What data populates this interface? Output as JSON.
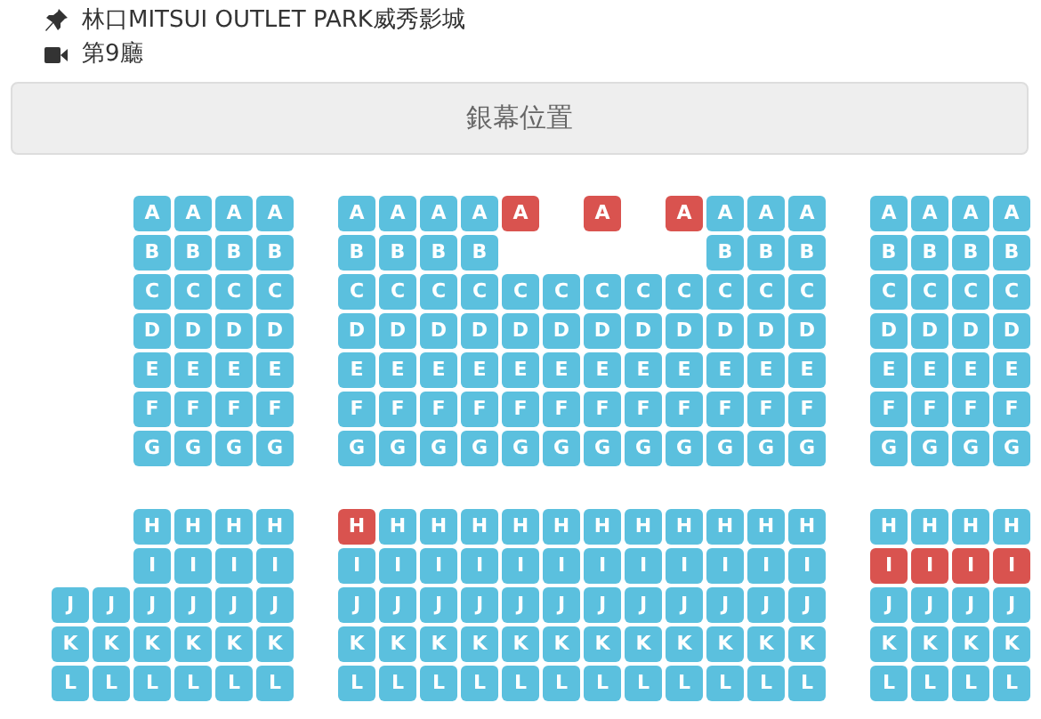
{
  "location": "林口MITSUI OUTLET PARK威秀影城",
  "hall": "第9廳",
  "screen": "銀幕位置",
  "sections": [
    {
      "rows": [
        {
          "seats": [
            {
              "kind": "gap"
            },
            {
              "kind": "gap"
            },
            {
              "kind": "seat",
              "label": "A",
              "taken": false
            },
            {
              "kind": "seat",
              "label": "A",
              "taken": false
            },
            {
              "kind": "seat",
              "label": "A",
              "taken": false
            },
            {
              "kind": "seat",
              "label": "A",
              "taken": false
            },
            {
              "kind": "gap"
            },
            {
              "kind": "seat",
              "label": "A",
              "taken": false
            },
            {
              "kind": "seat",
              "label": "A",
              "taken": false
            },
            {
              "kind": "seat",
              "label": "A",
              "taken": false
            },
            {
              "kind": "seat",
              "label": "A",
              "taken": false
            },
            {
              "kind": "seat",
              "label": "A",
              "taken": true
            },
            {
              "kind": "gap"
            },
            {
              "kind": "seat",
              "label": "A",
              "taken": true
            },
            {
              "kind": "gap"
            },
            {
              "kind": "seat",
              "label": "A",
              "taken": true
            },
            {
              "kind": "seat",
              "label": "A",
              "taken": false
            },
            {
              "kind": "seat",
              "label": "A",
              "taken": false
            },
            {
              "kind": "seat",
              "label": "A",
              "taken": false
            },
            {
              "kind": "gap"
            },
            {
              "kind": "seat",
              "label": "A",
              "taken": false
            },
            {
              "kind": "seat",
              "label": "A",
              "taken": false
            },
            {
              "kind": "seat",
              "label": "A",
              "taken": false
            },
            {
              "kind": "seat",
              "label": "A",
              "taken": false
            }
          ]
        },
        {
          "seats": [
            {
              "kind": "gap"
            },
            {
              "kind": "gap"
            },
            {
              "kind": "seat",
              "label": "B",
              "taken": false
            },
            {
              "kind": "seat",
              "label": "B",
              "taken": false
            },
            {
              "kind": "seat",
              "label": "B",
              "taken": false
            },
            {
              "kind": "seat",
              "label": "B",
              "taken": false
            },
            {
              "kind": "gap"
            },
            {
              "kind": "seat",
              "label": "B",
              "taken": false
            },
            {
              "kind": "seat",
              "label": "B",
              "taken": false
            },
            {
              "kind": "seat",
              "label": "B",
              "taken": false
            },
            {
              "kind": "seat",
              "label": "B",
              "taken": false
            },
            {
              "kind": "gap"
            },
            {
              "kind": "gap"
            },
            {
              "kind": "gap"
            },
            {
              "kind": "gap"
            },
            {
              "kind": "gap"
            },
            {
              "kind": "seat",
              "label": "B",
              "taken": false
            },
            {
              "kind": "seat",
              "label": "B",
              "taken": false
            },
            {
              "kind": "seat",
              "label": "B",
              "taken": false
            },
            {
              "kind": "gap"
            },
            {
              "kind": "seat",
              "label": "B",
              "taken": false
            },
            {
              "kind": "seat",
              "label": "B",
              "taken": false
            },
            {
              "kind": "seat",
              "label": "B",
              "taken": false
            },
            {
              "kind": "seat",
              "label": "B",
              "taken": false
            }
          ]
        },
        {
          "seats": [
            {
              "kind": "gap"
            },
            {
              "kind": "gap"
            },
            {
              "kind": "seat",
              "label": "C",
              "taken": false
            },
            {
              "kind": "seat",
              "label": "C",
              "taken": false
            },
            {
              "kind": "seat",
              "label": "C",
              "taken": false
            },
            {
              "kind": "seat",
              "label": "C",
              "taken": false
            },
            {
              "kind": "gap"
            },
            {
              "kind": "seat",
              "label": "C",
              "taken": false
            },
            {
              "kind": "seat",
              "label": "C",
              "taken": false
            },
            {
              "kind": "seat",
              "label": "C",
              "taken": false
            },
            {
              "kind": "seat",
              "label": "C",
              "taken": false
            },
            {
              "kind": "seat",
              "label": "C",
              "taken": false
            },
            {
              "kind": "seat",
              "label": "C",
              "taken": false
            },
            {
              "kind": "seat",
              "label": "C",
              "taken": false
            },
            {
              "kind": "seat",
              "label": "C",
              "taken": false
            },
            {
              "kind": "seat",
              "label": "C",
              "taken": false
            },
            {
              "kind": "seat",
              "label": "C",
              "taken": false
            },
            {
              "kind": "seat",
              "label": "C",
              "taken": false
            },
            {
              "kind": "seat",
              "label": "C",
              "taken": false
            },
            {
              "kind": "gap"
            },
            {
              "kind": "seat",
              "label": "C",
              "taken": false
            },
            {
              "kind": "seat",
              "label": "C",
              "taken": false
            },
            {
              "kind": "seat",
              "label": "C",
              "taken": false
            },
            {
              "kind": "seat",
              "label": "C",
              "taken": false
            }
          ]
        },
        {
          "seats": [
            {
              "kind": "gap"
            },
            {
              "kind": "gap"
            },
            {
              "kind": "seat",
              "label": "D",
              "taken": false
            },
            {
              "kind": "seat",
              "label": "D",
              "taken": false
            },
            {
              "kind": "seat",
              "label": "D",
              "taken": false
            },
            {
              "kind": "seat",
              "label": "D",
              "taken": false
            },
            {
              "kind": "gap"
            },
            {
              "kind": "seat",
              "label": "D",
              "taken": false
            },
            {
              "kind": "seat",
              "label": "D",
              "taken": false
            },
            {
              "kind": "seat",
              "label": "D",
              "taken": false
            },
            {
              "kind": "seat",
              "label": "D",
              "taken": false
            },
            {
              "kind": "seat",
              "label": "D",
              "taken": false
            },
            {
              "kind": "seat",
              "label": "D",
              "taken": false
            },
            {
              "kind": "seat",
              "label": "D",
              "taken": false
            },
            {
              "kind": "seat",
              "label": "D",
              "taken": false
            },
            {
              "kind": "seat",
              "label": "D",
              "taken": false
            },
            {
              "kind": "seat",
              "label": "D",
              "taken": false
            },
            {
              "kind": "seat",
              "label": "D",
              "taken": false
            },
            {
              "kind": "seat",
              "label": "D",
              "taken": false
            },
            {
              "kind": "gap"
            },
            {
              "kind": "seat",
              "label": "D",
              "taken": false
            },
            {
              "kind": "seat",
              "label": "D",
              "taken": false
            },
            {
              "kind": "seat",
              "label": "D",
              "taken": false
            },
            {
              "kind": "seat",
              "label": "D",
              "taken": false
            }
          ]
        },
        {
          "seats": [
            {
              "kind": "gap"
            },
            {
              "kind": "gap"
            },
            {
              "kind": "seat",
              "label": "E",
              "taken": false
            },
            {
              "kind": "seat",
              "label": "E",
              "taken": false
            },
            {
              "kind": "seat",
              "label": "E",
              "taken": false
            },
            {
              "kind": "seat",
              "label": "E",
              "taken": false
            },
            {
              "kind": "gap"
            },
            {
              "kind": "seat",
              "label": "E",
              "taken": false
            },
            {
              "kind": "seat",
              "label": "E",
              "taken": false
            },
            {
              "kind": "seat",
              "label": "E",
              "taken": false
            },
            {
              "kind": "seat",
              "label": "E",
              "taken": false
            },
            {
              "kind": "seat",
              "label": "E",
              "taken": false
            },
            {
              "kind": "seat",
              "label": "E",
              "taken": false
            },
            {
              "kind": "seat",
              "label": "E",
              "taken": false
            },
            {
              "kind": "seat",
              "label": "E",
              "taken": false
            },
            {
              "kind": "seat",
              "label": "E",
              "taken": false
            },
            {
              "kind": "seat",
              "label": "E",
              "taken": false
            },
            {
              "kind": "seat",
              "label": "E",
              "taken": false
            },
            {
              "kind": "seat",
              "label": "E",
              "taken": false
            },
            {
              "kind": "gap"
            },
            {
              "kind": "seat",
              "label": "E",
              "taken": false
            },
            {
              "kind": "seat",
              "label": "E",
              "taken": false
            },
            {
              "kind": "seat",
              "label": "E",
              "taken": false
            },
            {
              "kind": "seat",
              "label": "E",
              "taken": false
            }
          ]
        },
        {
          "seats": [
            {
              "kind": "gap"
            },
            {
              "kind": "gap"
            },
            {
              "kind": "seat",
              "label": "F",
              "taken": false
            },
            {
              "kind": "seat",
              "label": "F",
              "taken": false
            },
            {
              "kind": "seat",
              "label": "F",
              "taken": false
            },
            {
              "kind": "seat",
              "label": "F",
              "taken": false
            },
            {
              "kind": "gap"
            },
            {
              "kind": "seat",
              "label": "F",
              "taken": false
            },
            {
              "kind": "seat",
              "label": "F",
              "taken": false
            },
            {
              "kind": "seat",
              "label": "F",
              "taken": false
            },
            {
              "kind": "seat",
              "label": "F",
              "taken": false
            },
            {
              "kind": "seat",
              "label": "F",
              "taken": false
            },
            {
              "kind": "seat",
              "label": "F",
              "taken": false
            },
            {
              "kind": "seat",
              "label": "F",
              "taken": false
            },
            {
              "kind": "seat",
              "label": "F",
              "taken": false
            },
            {
              "kind": "seat",
              "label": "F",
              "taken": false
            },
            {
              "kind": "seat",
              "label": "F",
              "taken": false
            },
            {
              "kind": "seat",
              "label": "F",
              "taken": false
            },
            {
              "kind": "seat",
              "label": "F",
              "taken": false
            },
            {
              "kind": "gap"
            },
            {
              "kind": "seat",
              "label": "F",
              "taken": false
            },
            {
              "kind": "seat",
              "label": "F",
              "taken": false
            },
            {
              "kind": "seat",
              "label": "F",
              "taken": false
            },
            {
              "kind": "seat",
              "label": "F",
              "taken": false
            }
          ]
        },
        {
          "seats": [
            {
              "kind": "gap"
            },
            {
              "kind": "gap"
            },
            {
              "kind": "seat",
              "label": "G",
              "taken": false
            },
            {
              "kind": "seat",
              "label": "G",
              "taken": false
            },
            {
              "kind": "seat",
              "label": "G",
              "taken": false
            },
            {
              "kind": "seat",
              "label": "G",
              "taken": false
            },
            {
              "kind": "gap"
            },
            {
              "kind": "seat",
              "label": "G",
              "taken": false
            },
            {
              "kind": "seat",
              "label": "G",
              "taken": false
            },
            {
              "kind": "seat",
              "label": "G",
              "taken": false
            },
            {
              "kind": "seat",
              "label": "G",
              "taken": false
            },
            {
              "kind": "seat",
              "label": "G",
              "taken": false
            },
            {
              "kind": "seat",
              "label": "G",
              "taken": false
            },
            {
              "kind": "seat",
              "label": "G",
              "taken": false
            },
            {
              "kind": "seat",
              "label": "G",
              "taken": false
            },
            {
              "kind": "seat",
              "label": "G",
              "taken": false
            },
            {
              "kind": "seat",
              "label": "G",
              "taken": false
            },
            {
              "kind": "seat",
              "label": "G",
              "taken": false
            },
            {
              "kind": "seat",
              "label": "G",
              "taken": false
            },
            {
              "kind": "gap"
            },
            {
              "kind": "seat",
              "label": "G",
              "taken": false
            },
            {
              "kind": "seat",
              "label": "G",
              "taken": false
            },
            {
              "kind": "seat",
              "label": "G",
              "taken": false
            },
            {
              "kind": "seat",
              "label": "G",
              "taken": false
            }
          ]
        }
      ]
    },
    {
      "rows": [
        {
          "seats": [
            {
              "kind": "gap"
            },
            {
              "kind": "gap"
            },
            {
              "kind": "seat",
              "label": "H",
              "taken": false
            },
            {
              "kind": "seat",
              "label": "H",
              "taken": false
            },
            {
              "kind": "seat",
              "label": "H",
              "taken": false
            },
            {
              "kind": "seat",
              "label": "H",
              "taken": false
            },
            {
              "kind": "gap"
            },
            {
              "kind": "seat",
              "label": "H",
              "taken": true
            },
            {
              "kind": "seat",
              "label": "H",
              "taken": false
            },
            {
              "kind": "seat",
              "label": "H",
              "taken": false
            },
            {
              "kind": "seat",
              "label": "H",
              "taken": false
            },
            {
              "kind": "seat",
              "label": "H",
              "taken": false
            },
            {
              "kind": "seat",
              "label": "H",
              "taken": false
            },
            {
              "kind": "seat",
              "label": "H",
              "taken": false
            },
            {
              "kind": "seat",
              "label": "H",
              "taken": false
            },
            {
              "kind": "seat",
              "label": "H",
              "taken": false
            },
            {
              "kind": "seat",
              "label": "H",
              "taken": false
            },
            {
              "kind": "seat",
              "label": "H",
              "taken": false
            },
            {
              "kind": "seat",
              "label": "H",
              "taken": false
            },
            {
              "kind": "gap"
            },
            {
              "kind": "seat",
              "label": "H",
              "taken": false
            },
            {
              "kind": "seat",
              "label": "H",
              "taken": false
            },
            {
              "kind": "seat",
              "label": "H",
              "taken": false
            },
            {
              "kind": "seat",
              "label": "H",
              "taken": false
            }
          ]
        },
        {
          "seats": [
            {
              "kind": "gap"
            },
            {
              "kind": "gap"
            },
            {
              "kind": "seat",
              "label": "I",
              "taken": false
            },
            {
              "kind": "seat",
              "label": "I",
              "taken": false
            },
            {
              "kind": "seat",
              "label": "I",
              "taken": false
            },
            {
              "kind": "seat",
              "label": "I",
              "taken": false
            },
            {
              "kind": "gap"
            },
            {
              "kind": "seat",
              "label": "I",
              "taken": false
            },
            {
              "kind": "seat",
              "label": "I",
              "taken": false
            },
            {
              "kind": "seat",
              "label": "I",
              "taken": false
            },
            {
              "kind": "seat",
              "label": "I",
              "taken": false
            },
            {
              "kind": "seat",
              "label": "I",
              "taken": false
            },
            {
              "kind": "seat",
              "label": "I",
              "taken": false
            },
            {
              "kind": "seat",
              "label": "I",
              "taken": false
            },
            {
              "kind": "seat",
              "label": "I",
              "taken": false
            },
            {
              "kind": "seat",
              "label": "I",
              "taken": false
            },
            {
              "kind": "seat",
              "label": "I",
              "taken": false
            },
            {
              "kind": "seat",
              "label": "I",
              "taken": false
            },
            {
              "kind": "seat",
              "label": "I",
              "taken": false
            },
            {
              "kind": "gap"
            },
            {
              "kind": "seat",
              "label": "I",
              "taken": true
            },
            {
              "kind": "seat",
              "label": "I",
              "taken": true
            },
            {
              "kind": "seat",
              "label": "I",
              "taken": true
            },
            {
              "kind": "seat",
              "label": "I",
              "taken": true
            }
          ]
        },
        {
          "seats": [
            {
              "kind": "seat",
              "label": "J",
              "taken": false
            },
            {
              "kind": "seat",
              "label": "J",
              "taken": false
            },
            {
              "kind": "seat",
              "label": "J",
              "taken": false
            },
            {
              "kind": "seat",
              "label": "J",
              "taken": false
            },
            {
              "kind": "seat",
              "label": "J",
              "taken": false
            },
            {
              "kind": "seat",
              "label": "J",
              "taken": false
            },
            {
              "kind": "gap"
            },
            {
              "kind": "seat",
              "label": "J",
              "taken": false
            },
            {
              "kind": "seat",
              "label": "J",
              "taken": false
            },
            {
              "kind": "seat",
              "label": "J",
              "taken": false
            },
            {
              "kind": "seat",
              "label": "J",
              "taken": false
            },
            {
              "kind": "seat",
              "label": "J",
              "taken": false
            },
            {
              "kind": "seat",
              "label": "J",
              "taken": false
            },
            {
              "kind": "seat",
              "label": "J",
              "taken": false
            },
            {
              "kind": "seat",
              "label": "J",
              "taken": false
            },
            {
              "kind": "seat",
              "label": "J",
              "taken": false
            },
            {
              "kind": "seat",
              "label": "J",
              "taken": false
            },
            {
              "kind": "seat",
              "label": "J",
              "taken": false
            },
            {
              "kind": "seat",
              "label": "J",
              "taken": false
            },
            {
              "kind": "gap"
            },
            {
              "kind": "seat",
              "label": "J",
              "taken": false
            },
            {
              "kind": "seat",
              "label": "J",
              "taken": false
            },
            {
              "kind": "seat",
              "label": "J",
              "taken": false
            },
            {
              "kind": "seat",
              "label": "J",
              "taken": false
            }
          ]
        },
        {
          "seats": [
            {
              "kind": "seat",
              "label": "K",
              "taken": false
            },
            {
              "kind": "seat",
              "label": "K",
              "taken": false
            },
            {
              "kind": "seat",
              "label": "K",
              "taken": false
            },
            {
              "kind": "seat",
              "label": "K",
              "taken": false
            },
            {
              "kind": "seat",
              "label": "K",
              "taken": false
            },
            {
              "kind": "seat",
              "label": "K",
              "taken": false
            },
            {
              "kind": "gap"
            },
            {
              "kind": "seat",
              "label": "K",
              "taken": false
            },
            {
              "kind": "seat",
              "label": "K",
              "taken": false
            },
            {
              "kind": "seat",
              "label": "K",
              "taken": false
            },
            {
              "kind": "seat",
              "label": "K",
              "taken": false
            },
            {
              "kind": "seat",
              "label": "K",
              "taken": false
            },
            {
              "kind": "seat",
              "label": "K",
              "taken": false
            },
            {
              "kind": "seat",
              "label": "K",
              "taken": false
            },
            {
              "kind": "seat",
              "label": "K",
              "taken": false
            },
            {
              "kind": "seat",
              "label": "K",
              "taken": false
            },
            {
              "kind": "seat",
              "label": "K",
              "taken": false
            },
            {
              "kind": "seat",
              "label": "K",
              "taken": false
            },
            {
              "kind": "seat",
              "label": "K",
              "taken": false
            },
            {
              "kind": "gap"
            },
            {
              "kind": "seat",
              "label": "K",
              "taken": false
            },
            {
              "kind": "seat",
              "label": "K",
              "taken": false
            },
            {
              "kind": "seat",
              "label": "K",
              "taken": false
            },
            {
              "kind": "seat",
              "label": "K",
              "taken": false
            }
          ]
        },
        {
          "seats": [
            {
              "kind": "seat",
              "label": "L",
              "taken": false
            },
            {
              "kind": "seat",
              "label": "L",
              "taken": false
            },
            {
              "kind": "seat",
              "label": "L",
              "taken": false
            },
            {
              "kind": "seat",
              "label": "L",
              "taken": false
            },
            {
              "kind": "seat",
              "label": "L",
              "taken": false
            },
            {
              "kind": "seat",
              "label": "L",
              "taken": false
            },
            {
              "kind": "gap"
            },
            {
              "kind": "seat",
              "label": "L",
              "taken": false
            },
            {
              "kind": "seat",
              "label": "L",
              "taken": false
            },
            {
              "kind": "seat",
              "label": "L",
              "taken": false
            },
            {
              "kind": "seat",
              "label": "L",
              "taken": false
            },
            {
              "kind": "seat",
              "label": "L",
              "taken": false
            },
            {
              "kind": "seat",
              "label": "L",
              "taken": false
            },
            {
              "kind": "seat",
              "label": "L",
              "taken": false
            },
            {
              "kind": "seat",
              "label": "L",
              "taken": false
            },
            {
              "kind": "seat",
              "label": "L",
              "taken": false
            },
            {
              "kind": "seat",
              "label": "L",
              "taken": false
            },
            {
              "kind": "seat",
              "label": "L",
              "taken": false
            },
            {
              "kind": "seat",
              "label": "L",
              "taken": false
            },
            {
              "kind": "gap"
            },
            {
              "kind": "seat",
              "label": "L",
              "taken": false
            },
            {
              "kind": "seat",
              "label": "L",
              "taken": false
            },
            {
              "kind": "seat",
              "label": "L",
              "taken": false
            },
            {
              "kind": "seat",
              "label": "L",
              "taken": false
            }
          ]
        }
      ]
    }
  ]
}
